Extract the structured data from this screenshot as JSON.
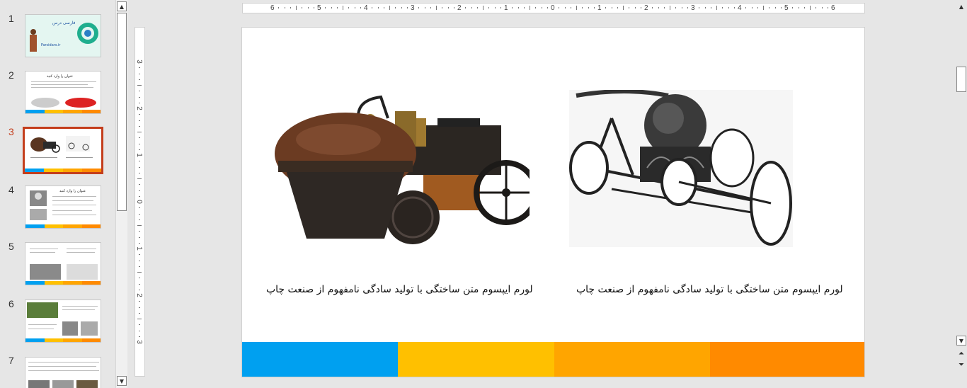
{
  "thumbnails": [
    {
      "number": "1",
      "title": "فارسی درس",
      "subtitle": "Farsidars.ir",
      "active": false
    },
    {
      "number": "2",
      "title": "عنوان را وارد کنید",
      "active": false
    },
    {
      "number": "3",
      "active": true
    },
    {
      "number": "4",
      "title": "عنوان را وارد کنید",
      "active": false
    },
    {
      "number": "5",
      "active": false
    },
    {
      "number": "6",
      "active": false
    },
    {
      "number": "7",
      "active": false
    }
  ],
  "ruler": {
    "horizontal": [
      "6",
      "5",
      "4",
      "3",
      "2",
      "1",
      "0",
      "1",
      "2",
      "3",
      "4",
      "5",
      "6"
    ],
    "vertical": [
      "3",
      "2",
      "1",
      "0",
      "1",
      "2",
      "3"
    ]
  },
  "slide": {
    "caption_left": "لورم ایپسوم متن ساختگی با تولید سادگی نامفهوم از صنعت چاپ",
    "caption_right": "لورم ایپسوم متن ساختگی با تولید سادگی نامفهوم از صنعت چاپ"
  },
  "colors": {
    "active_border": "#c43e1c",
    "bar_blue": "#00a0f0",
    "bar_yellow": "#ffc000",
    "bar_amber": "#ffa500",
    "bar_orange": "#ff8a00"
  }
}
